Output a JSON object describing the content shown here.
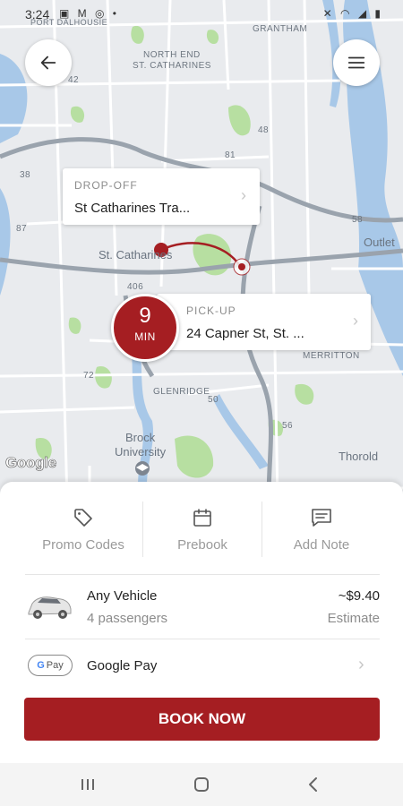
{
  "status_bar": {
    "time": "3:24",
    "left_icons": "▣ M ◎ •",
    "right_icons": "✕ ◠ ◢ ▮"
  },
  "map": {
    "labels": {
      "port_dalhousie": "PORT DALHOUSIE",
      "grantham": "GRANTHAM",
      "north_end": "NORTH END",
      "st_catharines_area": "ST. CATHARINES",
      "st_catharines_city": "St. Catharines",
      "outlet": "Outlet",
      "merritton": "MERRITTON",
      "glenridge": "GLENRIDGE",
      "brock": "Brock",
      "university": "University",
      "thorold": "Thorold"
    },
    "highway_shields": [
      "42",
      "48",
      "38",
      "81",
      "406",
      "72",
      "50",
      "56",
      "58",
      "87"
    ],
    "attribution": "Google"
  },
  "dropoff": {
    "label": "DROP-OFF",
    "address": "St Catharines Tra..."
  },
  "pickup": {
    "label": "PICK-UP",
    "address": "24 Capner St, St. ..."
  },
  "eta": {
    "value": "9",
    "unit": "MIN"
  },
  "options": [
    {
      "label": "Promo Codes",
      "icon": "tag-icon"
    },
    {
      "label": "Prebook",
      "icon": "calendar-icon"
    },
    {
      "label": "Add Note",
      "icon": "note-icon"
    }
  ],
  "vehicle": {
    "name": "Any Vehicle",
    "capacity": "4 passengers",
    "price": "~$9.40",
    "price_label": "Estimate"
  },
  "payment": {
    "method": "Google Pay",
    "badge_g": "G",
    "badge_text": "Pay"
  },
  "book_button": "BOOK NOW",
  "colors": {
    "brand": "#a51e22",
    "map_bg": "#e9ebee",
    "water": "#a8c8e8",
    "park": "#b7dfa1"
  }
}
